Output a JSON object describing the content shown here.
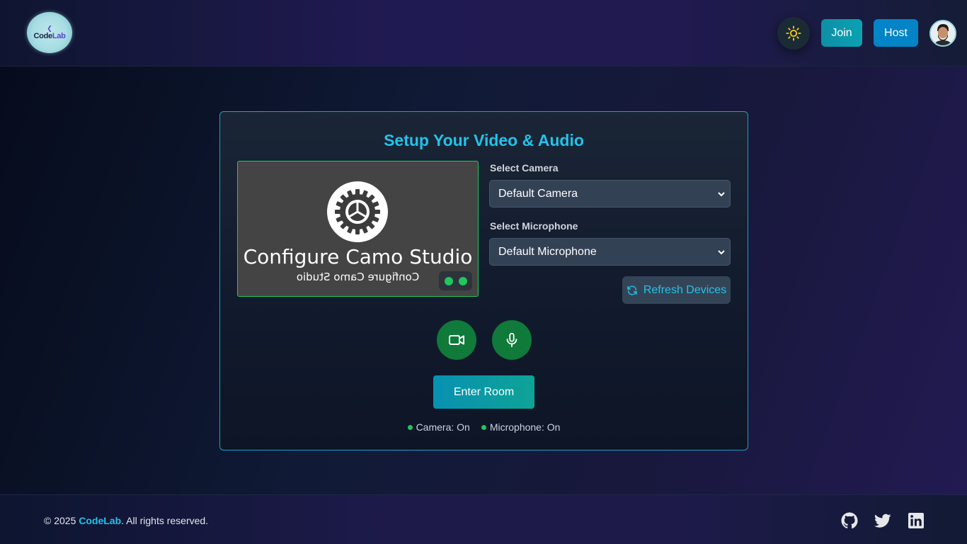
{
  "header": {
    "logo": {
      "glyph": "❮",
      "text_main": "Code",
      "text_accent": "Lab"
    },
    "theme_toggle_icon": "sun-icon",
    "join_label": "Join",
    "host_label": "Host",
    "avatar_icon": "user-avatar"
  },
  "setup": {
    "title": "Setup Your Video & Audio",
    "preview": {
      "overlay_title": "Configure Camo Studio",
      "overlay_mirror": "Configure Camo Studio",
      "indicator_color": "#22c55e"
    },
    "camera_label": "Select Camera",
    "camera_value": "Default Camera",
    "microphone_label": "Select Microphone",
    "microphone_value": "Default Microphone",
    "refresh_label": "Refresh Devices",
    "camera_toggle_icon": "video-camera-icon",
    "mic_toggle_icon": "microphone-icon",
    "enter_label": "Enter Room",
    "status": {
      "camera": "Camera: On",
      "microphone": "Microphone: On"
    }
  },
  "footer": {
    "copyright_prefix": "© 2025 ",
    "brand": "CodeLab",
    "copyright_suffix": ". All rights reserved.",
    "social_icons": [
      "github-icon",
      "twitter-icon",
      "linkedin-icon"
    ]
  },
  "colors": {
    "accent": "#22c3ea",
    "success": "#22c55e",
    "host_button": "#0284c7",
    "join_button": "#0aa2b3"
  }
}
